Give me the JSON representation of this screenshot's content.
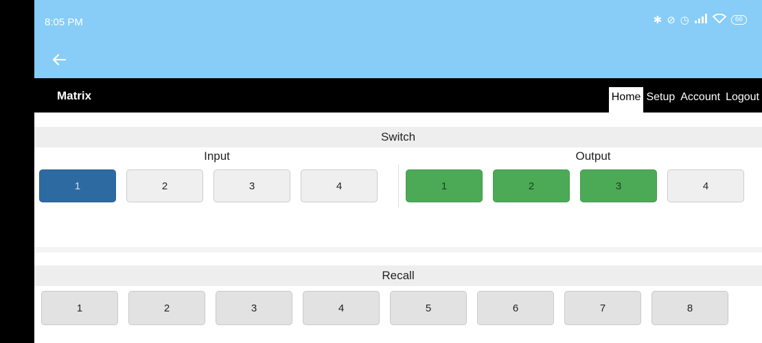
{
  "status_bar": {
    "time": "8:05 PM",
    "icons": [
      "bluetooth-icon",
      "alarm-off-icon",
      "alarm-icon",
      "signal-icon",
      "wifi-icon"
    ],
    "battery": "66"
  },
  "nav": {
    "brand": "Matrix",
    "links": [
      {
        "label": "Home",
        "active": true
      },
      {
        "label": "Setup",
        "active": false
      },
      {
        "label": "Account",
        "active": false
      },
      {
        "label": "Logout",
        "active": false
      }
    ]
  },
  "switch": {
    "title": "Switch",
    "input_label": "Input",
    "output_label": "Output",
    "inputs": [
      {
        "label": "1",
        "selected": true
      },
      {
        "label": "2",
        "selected": false
      },
      {
        "label": "3",
        "selected": false
      },
      {
        "label": "4",
        "selected": false
      }
    ],
    "outputs": [
      {
        "label": "1",
        "selected": true
      },
      {
        "label": "2",
        "selected": true
      },
      {
        "label": "3",
        "selected": true
      },
      {
        "label": "4",
        "selected": false
      }
    ]
  },
  "recall": {
    "title": "Recall",
    "presets": [
      "1",
      "2",
      "3",
      "4",
      "5",
      "6",
      "7",
      "8"
    ]
  },
  "colors": {
    "status_bar": "#87cdf7",
    "input_selected": "#2e6aa2",
    "output_selected": "#4caa56",
    "nav_bar": "#000000"
  }
}
